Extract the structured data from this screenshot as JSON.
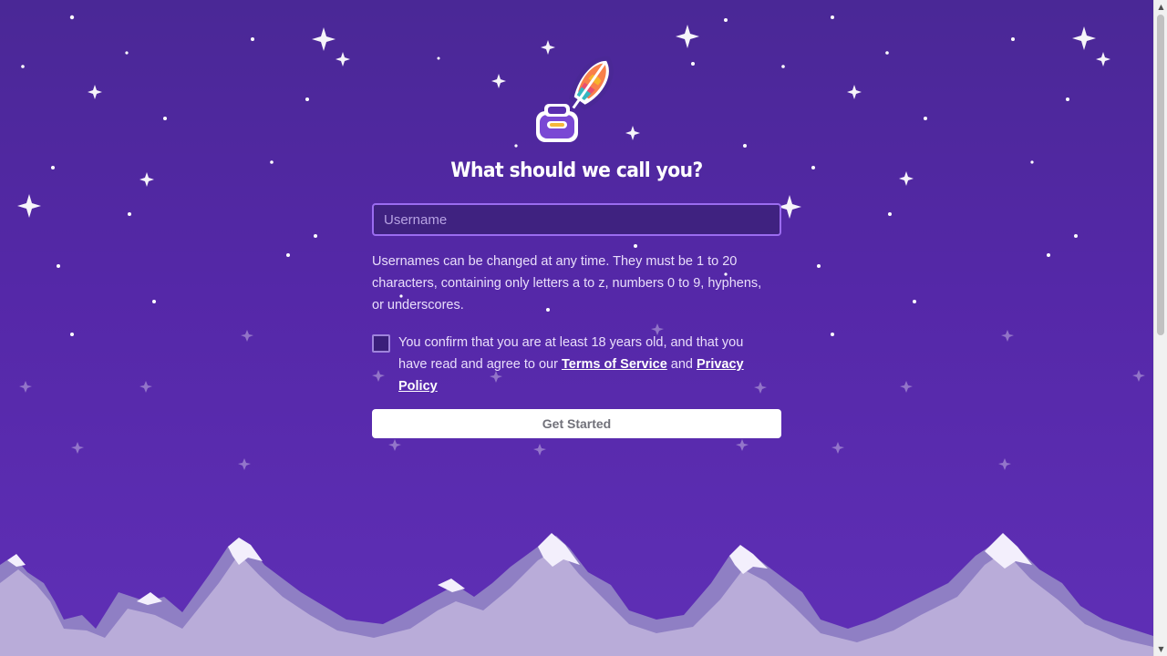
{
  "signup": {
    "heading": "What should we call you?",
    "username_placeholder": "Username",
    "username_value": "",
    "hint": "Usernames can be changed at any time. They must be 1 to 20 characters, containing only letters a to z, numbers 0 to 9, hyphens, or underscores.",
    "consent_prefix": "You confirm that you are at least 18 years old, and that you have read and agree to our ",
    "terms_link": "Terms of Service",
    "consent_and": " and ",
    "privacy_link": "Privacy Policy",
    "confirm_checked": false,
    "submit_label": "Get Started"
  },
  "icons": {
    "logo": "quill-inkwell-logo",
    "checkbox": "checkbox-unchecked-icon",
    "scroll_up": "chevron-up-icon",
    "scroll_down": "chevron-down-icon"
  },
  "colors": {
    "background": "#5528a8",
    "input_bg": "#3f2280",
    "input_border": "#9b6cf0",
    "button_bg": "#ffffff",
    "button_text": "#71717a",
    "mountain": "#b9acd9"
  }
}
